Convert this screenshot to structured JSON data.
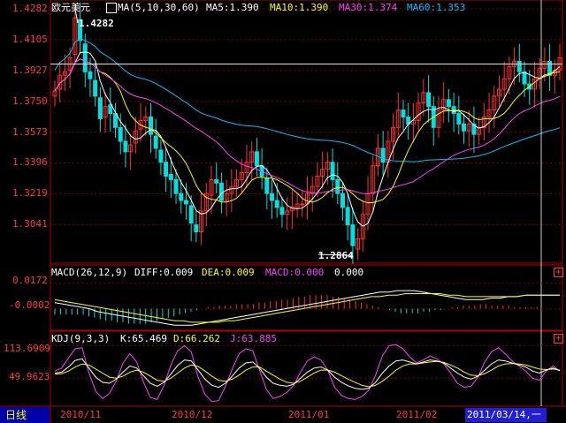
{
  "main": {
    "symbol": "欧元美元",
    "ma_params": "MA(5,10,30,60)",
    "ma5": "MA5:1.390",
    "ma10": "MA10:1.390",
    "ma30": "MA30:1.374",
    "ma60": "MA60:1.353",
    "high_label": "1.4282",
    "low_label": "1.2864",
    "y_ticks": [
      "1.4282",
      "1.4105",
      "1.3927",
      "1.3750",
      "1.3573",
      "1.3396",
      "1.3219",
      "1.3041"
    ]
  },
  "macd": {
    "params": "MACD(26,12,9)",
    "diff": "DIFF:0.009",
    "dea": "DEA:0.009",
    "macd": "MACD:0.000",
    "extra": "0.000",
    "y_ticks": [
      "0.0172",
      "-0.0002"
    ]
  },
  "kdj": {
    "params": "KDJ(9,3,3)",
    "k": "K:65.469",
    "d": "D:66.262",
    "j": "J:63.885",
    "y_ticks": [
      "113.6909",
      "49.9623"
    ]
  },
  "bottom": {
    "period_tab": "日线",
    "x_ticks": [
      "2010/11",
      "2010/12",
      "2011/01",
      "2011/02"
    ],
    "cursor_date": "2011/03/14,一"
  },
  "colors": {
    "up": "#ff3030",
    "down": "#00e0e0",
    "ma5": "#ffffff",
    "ma10": "#ffff00",
    "ma30": "#ff40ff",
    "ma60": "#00c0ff",
    "axis": "#b00000",
    "grid": "#800000"
  },
  "chart_data": [
    {
      "type": "candlestick",
      "ylim": [
        1.285,
        1.4282
      ],
      "series": [
        {
          "name": "MA5",
          "values": []
        },
        {
          "name": "MA10",
          "values": []
        },
        {
          "name": "MA30",
          "values": []
        },
        {
          "name": "MA60",
          "values": []
        }
      ],
      "close": [
        1.381,
        1.39,
        1.392,
        1.4,
        1.423,
        1.41,
        1.392,
        1.388,
        1.378,
        1.365,
        1.372,
        1.368,
        1.36,
        1.352,
        1.346,
        1.35,
        1.358,
        1.364,
        1.366,
        1.356,
        1.348,
        1.34,
        1.332,
        1.33,
        1.322,
        1.318,
        1.316,
        1.305,
        1.3,
        1.312,
        1.322,
        1.33,
        1.328,
        1.318,
        1.322,
        1.326,
        1.33,
        1.334,
        1.34,
        1.346,
        1.338,
        1.332,
        1.322,
        1.318,
        1.314,
        1.31,
        1.312,
        1.314,
        1.316,
        1.316,
        1.322,
        1.326,
        1.332,
        1.336,
        1.34,
        1.33,
        1.322,
        1.314,
        1.304,
        1.292,
        1.296,
        1.31,
        1.322,
        1.338,
        1.348,
        1.34,
        1.352,
        1.36,
        1.37,
        1.366,
        1.362,
        1.364,
        1.374,
        1.38,
        1.372,
        1.36,
        1.37,
        1.376,
        1.372,
        1.368,
        1.362,
        1.358,
        1.362,
        1.356,
        1.36,
        1.366,
        1.37,
        1.378,
        1.382,
        1.388,
        1.395,
        1.398,
        1.392,
        1.385,
        1.382,
        1.388,
        1.394,
        1.398,
        1.39,
        1.393,
        1.4
      ],
      "open": [
        1.378,
        1.382,
        1.39,
        1.393,
        1.402,
        1.422,
        1.408,
        1.392,
        1.387,
        1.377,
        1.366,
        1.373,
        1.368,
        1.36,
        1.352,
        1.346,
        1.351,
        1.359,
        1.364,
        1.366,
        1.355,
        1.347,
        1.34,
        1.333,
        1.33,
        1.322,
        1.318,
        1.315,
        1.304,
        1.3,
        1.312,
        1.321,
        1.33,
        1.328,
        1.318,
        1.322,
        1.326,
        1.33,
        1.334,
        1.34,
        1.346,
        1.338,
        1.331,
        1.322,
        1.318,
        1.314,
        1.31,
        1.312,
        1.314,
        1.316,
        1.316,
        1.322,
        1.326,
        1.332,
        1.336,
        1.34,
        1.33,
        1.322,
        1.314,
        1.304,
        1.29,
        1.296,
        1.31,
        1.322,
        1.338,
        1.348,
        1.34,
        1.352,
        1.36,
        1.37,
        1.366,
        1.362,
        1.364,
        1.374,
        1.38,
        1.372,
        1.36,
        1.37,
        1.376,
        1.372,
        1.368,
        1.362,
        1.358,
        1.362,
        1.356,
        1.36,
        1.366,
        1.37,
        1.378,
        1.382,
        1.388,
        1.395,
        1.398,
        1.392,
        1.385,
        1.382,
        1.388,
        1.394,
        1.398,
        1.39,
        1.393
      ],
      "high_mark": 1.4282,
      "low_mark": 1.2864
    },
    {
      "type": "bar",
      "title": "MACD(26,12,9)",
      "ylim": [
        -0.012,
        0.022
      ],
      "values": [
        -0.004,
        -0.004,
        -0.004,
        -0.004,
        -0.004,
        -0.004,
        -0.005,
        -0.006,
        -0.007,
        -0.008,
        -0.008,
        -0.009,
        -0.009,
        -0.01,
        -0.01,
        -0.01,
        -0.01,
        -0.009,
        -0.008,
        -0.007,
        -0.006,
        -0.005,
        -0.004,
        -0.003,
        -0.002,
        -0.001,
        0.0,
        0.001,
        0.001,
        0.002,
        0.002,
        0.002,
        0.003,
        0.003,
        0.003,
        0.003,
        0.004,
        0.004,
        0.005,
        0.005,
        0.006,
        0.006,
        0.007,
        0.008,
        0.008,
        0.009,
        0.009,
        0.009,
        0.009,
        0.008,
        0.008,
        0.007,
        0.006,
        0.005,
        0.004,
        0.003,
        0.002,
        0.001,
        0.0,
        -0.001,
        -0.002,
        -0.003,
        -0.003,
        -0.003,
        -0.003,
        -0.002,
        -0.002,
        -0.001,
        -0.001,
        0.0,
        0.001,
        0.001,
        0.002,
        0.002,
        0.002,
        0.003,
        0.003,
        0.002,
        0.002,
        0.002,
        0.002,
        0.001,
        0.001,
        0.001,
        0.001,
        0.001,
        0.0,
        0.0,
        0.0,
        0.0
      ],
      "diff": [
        0.004,
        0.003,
        0.002,
        0.001,
        0.0,
        -0.002,
        -0.003,
        -0.004,
        -0.005,
        -0.006,
        -0.007,
        -0.008,
        -0.009,
        -0.01,
        -0.011,
        -0.011,
        -0.011,
        -0.01,
        -0.009,
        -0.008,
        -0.007,
        -0.006,
        -0.005,
        -0.004,
        -0.003,
        -0.002,
        -0.001,
        0.0,
        0.001,
        0.002,
        0.003,
        0.004,
        0.005,
        0.006,
        0.007,
        0.008,
        0.009,
        0.01,
        0.011,
        0.011,
        0.012,
        0.012,
        0.012,
        0.011,
        0.01,
        0.009,
        0.008,
        0.007,
        0.006,
        0.006,
        0.006,
        0.007,
        0.007,
        0.008,
        0.008,
        0.009,
        0.009,
        0.009,
        0.009,
        0.009
      ],
      "dea": [
        0.006,
        0.005,
        0.004,
        0.003,
        0.002,
        0.001,
        0.0,
        -0.001,
        -0.002,
        -0.003,
        -0.004,
        -0.005,
        -0.006,
        -0.007,
        -0.008,
        -0.008,
        -0.009,
        -0.009,
        -0.009,
        -0.009,
        -0.008,
        -0.008,
        -0.007,
        -0.006,
        -0.005,
        -0.004,
        -0.003,
        -0.002,
        -0.001,
        0.0,
        0.001,
        0.002,
        0.003,
        0.004,
        0.005,
        0.006,
        0.007,
        0.008,
        0.008,
        0.009,
        0.009,
        0.01,
        0.01,
        0.01,
        0.01,
        0.01,
        0.009,
        0.009,
        0.008,
        0.008,
        0.008,
        0.008,
        0.008,
        0.008,
        0.008,
        0.009,
        0.009,
        0.009,
        0.009,
        0.009
      ]
    },
    {
      "type": "line",
      "title": "KDJ(9,3,3)",
      "ylim": [
        0,
        120
      ],
      "series": [
        {
          "name": "K",
          "values": [
            60,
            62,
            72,
            85,
            88,
            70,
            52,
            42,
            40,
            48,
            62,
            74,
            70,
            55,
            40,
            34,
            42,
            58,
            75,
            86,
            84,
            66,
            48,
            36,
            32,
            40,
            54,
            70,
            80,
            82,
            70,
            52,
            40,
            36,
            34,
            38,
            50,
            62,
            70,
            72,
            66,
            52,
            42,
            35,
            30,
            28,
            30,
            42,
            60,
            74,
            84,
            86,
            82,
            78,
            82,
            86,
            84,
            80,
            70,
            60,
            52,
            48,
            54,
            66,
            78,
            86,
            84,
            80,
            76,
            72,
            64,
            60,
            66,
            70,
            65
          ]
        },
        {
          "name": "D",
          "values": [
            58,
            59,
            64,
            72,
            78,
            76,
            68,
            60,
            52,
            50,
            54,
            62,
            66,
            62,
            54,
            46,
            44,
            50,
            60,
            70,
            76,
            73,
            64,
            54,
            46,
            44,
            48,
            56,
            66,
            72,
            72,
            64,
            56,
            48,
            42,
            40,
            44,
            52,
            60,
            66,
            66,
            62,
            55,
            48,
            42,
            36,
            33,
            36,
            44,
            54,
            66,
            74,
            78,
            78,
            80,
            82,
            83,
            81,
            76,
            70,
            62,
            56,
            55,
            59,
            66,
            74,
            78,
            79,
            78,
            76,
            72,
            68,
            67,
            68,
            66
          ]
        },
        {
          "name": "J",
          "values": [
            64,
            70,
            90,
            108,
            110,
            60,
            24,
            10,
            20,
            44,
            80,
            98,
            82,
            42,
            12,
            8,
            36,
            76,
            104,
            114,
            102,
            52,
            18,
            4,
            6,
            34,
            68,
            98,
            108,
            104,
            66,
            28,
            10,
            14,
            22,
            36,
            62,
            84,
            92,
            86,
            66,
            32,
            16,
            10,
            8,
            14,
            26,
            56,
            94,
            114,
            116,
            108,
            92,
            80,
            86,
            94,
            88,
            78,
            60,
            40,
            32,
            34,
            52,
            82,
            102,
            110,
            98,
            84,
            74,
            64,
            50,
            46,
            64,
            74,
            64
          ]
        }
      ]
    }
  ]
}
